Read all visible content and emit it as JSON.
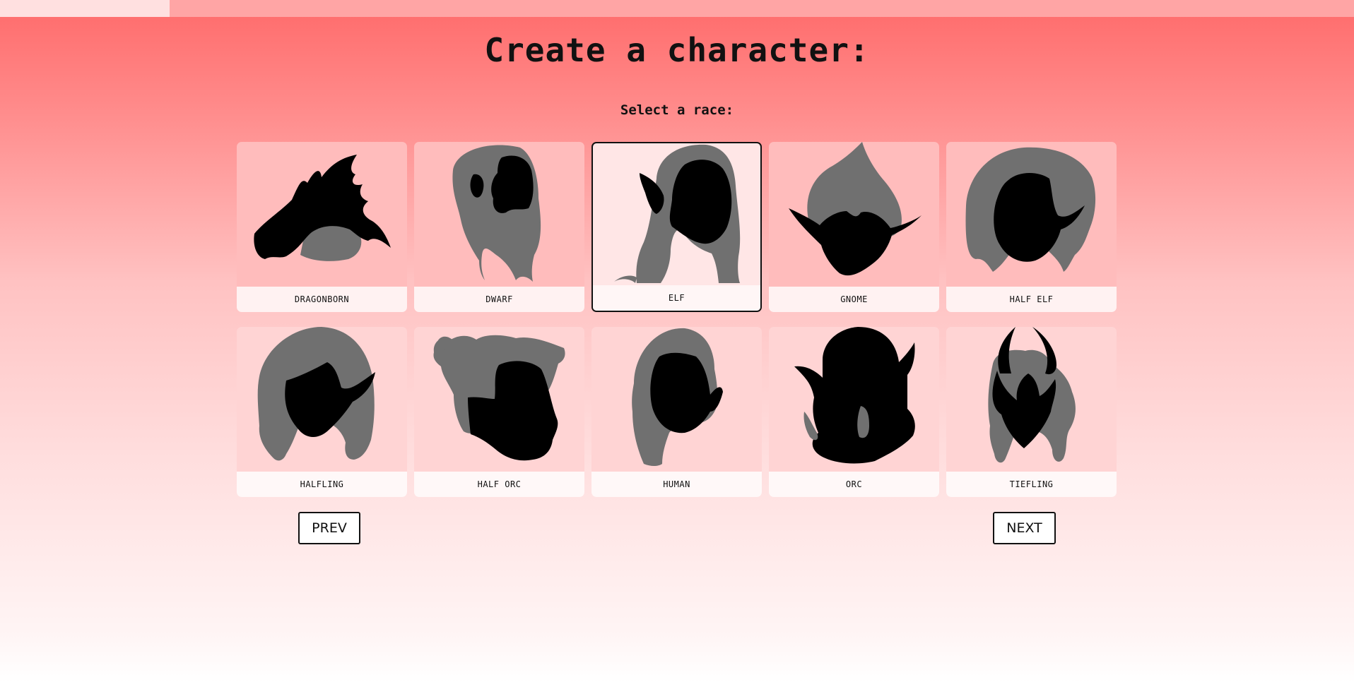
{
  "progress": {
    "fraction": 0.125
  },
  "header": {
    "title": "Create a character:",
    "subtitle": "Select a race:"
  },
  "races": [
    {
      "label": "DRAGONBORN",
      "icon": "dragonborn-icon",
      "selected": false
    },
    {
      "label": "DWARF",
      "icon": "dwarf-icon",
      "selected": false
    },
    {
      "label": "ELF",
      "icon": "elf-icon",
      "selected": true
    },
    {
      "label": "GNOME",
      "icon": "gnome-icon",
      "selected": false
    },
    {
      "label": "HALF ELF",
      "icon": "half-elf-icon",
      "selected": false
    },
    {
      "label": "HALFLING",
      "icon": "halfling-icon",
      "selected": false
    },
    {
      "label": "HALF ORC",
      "icon": "half-orc-icon",
      "selected": false
    },
    {
      "label": "HUMAN",
      "icon": "human-icon",
      "selected": false
    },
    {
      "label": "ORC",
      "icon": "orc-icon",
      "selected": false
    },
    {
      "label": "TIEFLING",
      "icon": "tiefling-icon",
      "selected": false
    }
  ],
  "nav": {
    "prev_label": "PREV",
    "next_label": "NEXT"
  },
  "colors": {
    "hair": "#707070",
    "face": "#000000",
    "accent": "#ff6a6a"
  }
}
